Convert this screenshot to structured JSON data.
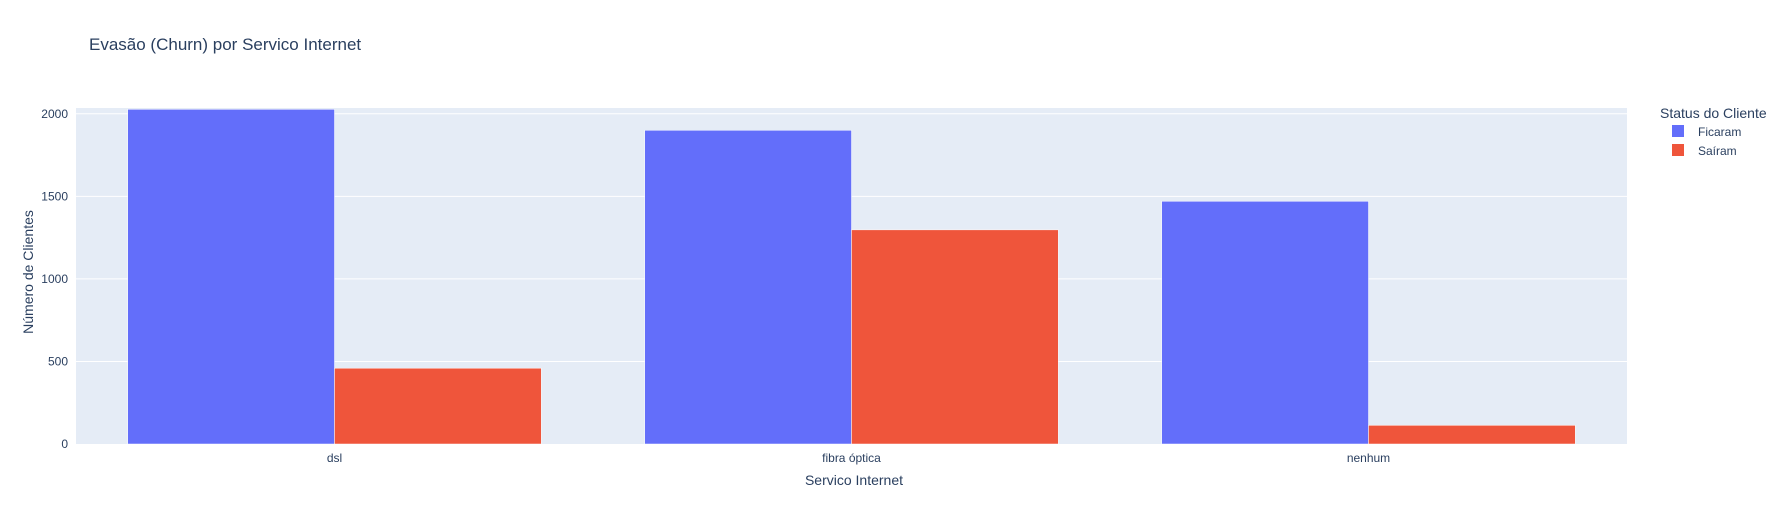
{
  "chart_data": {
    "type": "bar",
    "title": "Evasão (Churn) por Servico Internet",
    "xlabel": "Servico Internet",
    "ylabel": "Número de Clientes",
    "categories": [
      "dsl",
      "fibra óptica",
      "nenhum"
    ],
    "series": [
      {
        "name": "Ficaram",
        "values": [
          2027,
          1900,
          1470
        ],
        "color": "#636efa"
      },
      {
        "name": "Saíram",
        "values": [
          459,
          1297,
          113
        ],
        "color": "#ef553b"
      }
    ],
    "ylim": [
      0,
      2035
    ],
    "yticks": [
      0,
      500,
      1000,
      1500,
      2000
    ],
    "grid": true,
    "legend": {
      "title": "Status do Cliente",
      "placement": "top-right"
    },
    "colors": {
      "plot_bg": "#e5ecf6",
      "grid": "#ffffff",
      "text": "#2a3f5f"
    }
  }
}
